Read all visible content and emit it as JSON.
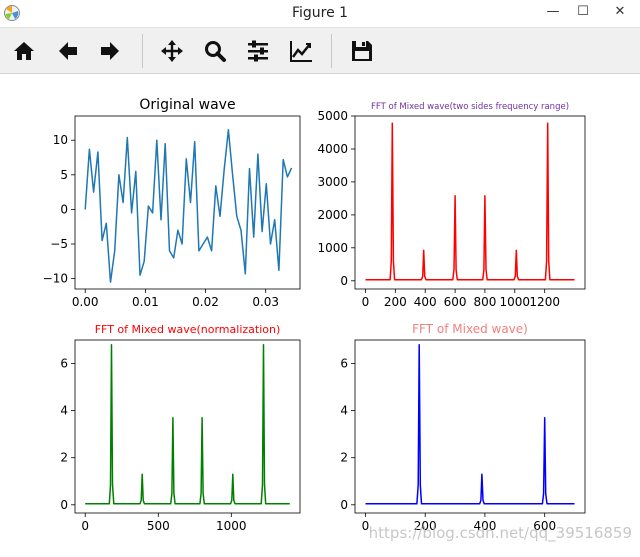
{
  "window": {
    "title": "Figure 1",
    "minimize_glyph": "—",
    "maximize_glyph": "☐",
    "close_glyph": "✕"
  },
  "toolbar": {
    "buttons": [
      {
        "name": "home",
        "icon": "home-icon"
      },
      {
        "name": "back",
        "icon": "arrow-left-icon"
      },
      {
        "name": "forward",
        "icon": "arrow-right-icon"
      },
      {
        "name": "pan",
        "icon": "move-icon"
      },
      {
        "name": "zoom",
        "icon": "magnifier-icon"
      },
      {
        "name": "subplots",
        "icon": "sliders-icon"
      },
      {
        "name": "edit-axis",
        "icon": "line-chart-icon"
      },
      {
        "name": "save",
        "icon": "floppy-disk-icon"
      }
    ]
  },
  "watermark": "https://blog.csdn.net/qq_39516859",
  "chart_data": [
    {
      "type": "line",
      "title": "Original wave",
      "title_color": "#000000",
      "color": "#1f77b4",
      "xlim": [
        -0.0017,
        0.0357
      ],
      "ylim": [
        -11.5,
        13.5
      ],
      "xticks": [
        0.0,
        0.01,
        0.02,
        0.03
      ],
      "xtick_labels": [
        "0.00",
        "0.01",
        "0.02",
        "0.03"
      ],
      "yticks": [
        -10,
        -5,
        0,
        5,
        10
      ],
      "ytick_labels": [
        "−10",
        "−5",
        "0",
        "5",
        "10"
      ],
      "x": [
        0.0,
        0.0007,
        0.0014,
        0.0021,
        0.0028,
        0.0035,
        0.0042,
        0.0049,
        0.0056,
        0.0063,
        0.007,
        0.0077,
        0.0084,
        0.0091,
        0.0098,
        0.0105,
        0.0112,
        0.0119,
        0.0126,
        0.0133,
        0.014,
        0.0147,
        0.0154,
        0.0161,
        0.0168,
        0.0175,
        0.0182,
        0.0189,
        0.0196,
        0.0203,
        0.021,
        0.0217,
        0.0224,
        0.0231,
        0.0238,
        0.0245,
        0.0252,
        0.0259,
        0.0266,
        0.0273,
        0.028,
        0.0287,
        0.0294,
        0.0301,
        0.0308,
        0.0315,
        0.0322,
        0.0329,
        0.0336,
        0.0343
      ],
      "y": [
        0.0,
        8.7,
        2.5,
        8.3,
        -4.5,
        -2.0,
        -10.5,
        -6.0,
        5.0,
        1.0,
        10.4,
        -0.5,
        5.5,
        -9.5,
        -7.5,
        0.5,
        -0.5,
        10.0,
        -1.5,
        9.5,
        -6.0,
        -7.0,
        -3.0,
        -5.0,
        7.3,
        1.0,
        9.8,
        -6.0,
        -5.0,
        -4.0,
        -6.0,
        3.4,
        -1.0,
        5.8,
        11.5,
        5.0,
        -1.0,
        -3.0,
        -9.3,
        5.9,
        -4.0,
        8.0,
        -3.2,
        3.7,
        -5.0,
        -1.5,
        -8.8,
        7.2,
        4.7,
        6.0
      ]
    },
    {
      "type": "line",
      "title": "FFT of Mixed wave(two sides frequency range)",
      "title_color": "#7030a0",
      "color": "#ff0000",
      "xlim": [
        -70,
        1470
      ],
      "ylim": [
        -250,
        5000
      ],
      "xticks": [
        0,
        200,
        400,
        600,
        800,
        1000,
        1200
      ],
      "xtick_labels": [
        "0",
        "200",
        "400",
        "600",
        "800",
        "1000",
        "1200"
      ],
      "yticks": [
        0,
        1000,
        2000,
        3000,
        4000,
        5000
      ],
      "ytick_labels": [
        "0",
        "1000",
        "2000",
        "3000",
        "4000",
        "5000"
      ],
      "baseline": 30,
      "peaks": [
        {
          "x": 180,
          "y": 4780
        },
        {
          "x": 390,
          "y": 920
        },
        {
          "x": 600,
          "y": 2580
        },
        {
          "x": 800,
          "y": 2580
        },
        {
          "x": 1010,
          "y": 920
        },
        {
          "x": 1220,
          "y": 4780
        }
      ],
      "xmax": 1400
    },
    {
      "type": "line",
      "title": "FFT of Mixed wave(normalization)",
      "title_color": "#ff0000",
      "color": "#008000",
      "xlim": [
        -70,
        1470
      ],
      "ylim": [
        -0.35,
        7.0
      ],
      "xticks": [
        0,
        500,
        1000
      ],
      "xtick_labels": [
        "0",
        "500",
        "1000"
      ],
      "yticks": [
        0,
        2,
        4,
        6
      ],
      "ytick_labels": [
        "0",
        "2",
        "4",
        "6"
      ],
      "baseline": 0.04,
      "peaks": [
        {
          "x": 180,
          "y": 6.8
        },
        {
          "x": 390,
          "y": 1.3
        },
        {
          "x": 600,
          "y": 3.7
        },
        {
          "x": 800,
          "y": 3.7
        },
        {
          "x": 1010,
          "y": 1.3
        },
        {
          "x": 1220,
          "y": 6.8
        }
      ],
      "xmax": 1400
    },
    {
      "type": "line",
      "title": "FFT of Mixed wave)",
      "title_color": "#f08080",
      "color": "#0000ff",
      "xlim": [
        -35,
        735
      ],
      "ylim": [
        -0.35,
        7.0
      ],
      "xticks": [
        0,
        200,
        400,
        600
      ],
      "xtick_labels": [
        "0",
        "200",
        "400",
        "600"
      ],
      "yticks": [
        0,
        2,
        4,
        6
      ],
      "ytick_labels": [
        "0",
        "2",
        "4",
        "6"
      ],
      "baseline": 0.04,
      "peaks": [
        {
          "x": 180,
          "y": 6.8
        },
        {
          "x": 390,
          "y": 1.3
        },
        {
          "x": 600,
          "y": 3.7
        }
      ],
      "xmax": 700
    }
  ]
}
